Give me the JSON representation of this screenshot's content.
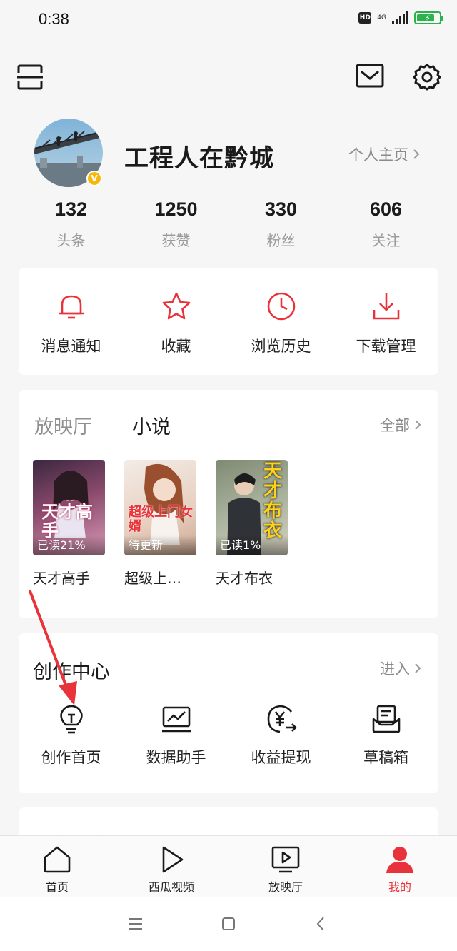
{
  "status_bar": {
    "time": "0:38",
    "hd_label": "HD",
    "network_label": "4G"
  },
  "profile": {
    "username": "工程人在黔城",
    "homepage_link": "个人主页",
    "verified_badge": "V",
    "stats": [
      {
        "value": "132",
        "label": "头条"
      },
      {
        "value": "1250",
        "label": "获赞"
      },
      {
        "value": "330",
        "label": "粉丝"
      },
      {
        "value": "606",
        "label": "关注"
      }
    ]
  },
  "quick_actions": [
    {
      "label": "消息通知",
      "icon": "bell-icon"
    },
    {
      "label": "收藏",
      "icon": "star-icon"
    },
    {
      "label": "浏览历史",
      "icon": "clock-icon"
    },
    {
      "label": "下载管理",
      "icon": "download-icon"
    }
  ],
  "media": {
    "tabs": [
      {
        "label": "放映厅",
        "active": false
      },
      {
        "label": "小说",
        "active": true
      }
    ],
    "all_link": "全部",
    "books": [
      {
        "title": "天才高手",
        "progress": "已读21%",
        "cover_text": "天才高手"
      },
      {
        "title": "超级上…",
        "progress": "待更新",
        "cover_text": "超级上门女婿"
      },
      {
        "title": "天才布衣",
        "progress": "已读1%",
        "cover_text": "天才布衣"
      }
    ]
  },
  "creation_center": {
    "title": "创作中心",
    "enter_link": "进入",
    "items": [
      {
        "label": "创作首页",
        "icon": "lightbulb-icon"
      },
      {
        "label": "数据助手",
        "icon": "chart-monitor-icon"
      },
      {
        "label": "收益提现",
        "icon": "yuan-withdraw-icon"
      },
      {
        "label": "草稿箱",
        "icon": "draft-box-icon"
      }
    ]
  },
  "more_services": {
    "title": "更多服务"
  },
  "tab_bar": [
    {
      "label": "首页",
      "icon": "home-icon",
      "active": false
    },
    {
      "label": "西瓜视频",
      "icon": "play-icon",
      "active": false
    },
    {
      "label": "放映厅",
      "icon": "tv-play-icon",
      "active": false
    },
    {
      "label": "我的",
      "icon": "person-icon",
      "active": true
    }
  ],
  "colors": {
    "accent": "#e8333a",
    "verified": "#f5b80b",
    "battery": "#2bb24c"
  }
}
